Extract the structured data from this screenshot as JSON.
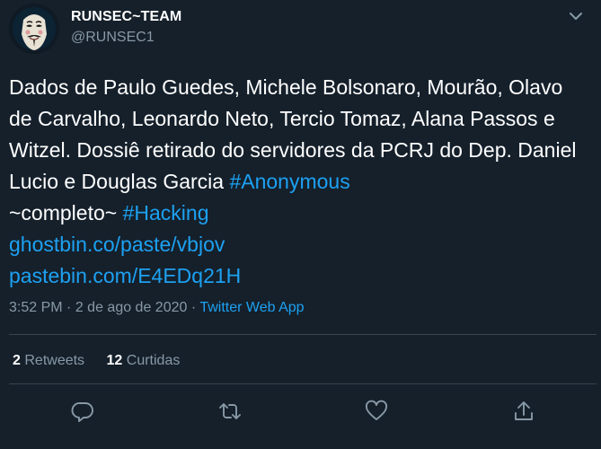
{
  "user": {
    "display_name": "RUNSEC~TEAM",
    "handle": "@RUNSEC1",
    "avatar_icon": "guy-fawkes-mask-avatar"
  },
  "tweet": {
    "text_plain": "Dados de Paulo Guedes, Michele Bolsonaro, Mourão, Olavo de Carvalho, Leonardo Neto, Tercio Tomaz, Alana Passos e Witzel. Dossiê retirado do servidores da PCRJ do Dep. Daniel Lucio e Douglas Garcia",
    "hashtag_1": "#Anonymous",
    "text_plain_2": "~completo~",
    "hashtag_2": "#Hacking",
    "link_1": "ghostbin.co/paste/vbjov",
    "link_2": "pastebin.com/E4EDq21H"
  },
  "meta": {
    "time": "3:52 PM",
    "separator": "·",
    "date": "2 de ago de 2020",
    "source": "Twitter Web App"
  },
  "stats": {
    "retweets_count": "2",
    "retweets_label": "Retweets",
    "likes_count": "12",
    "likes_label": "Curtidas"
  },
  "colors": {
    "background": "#15202b",
    "accent": "#1da1f2",
    "secondary_text": "#8899a6",
    "divider": "#38444d"
  }
}
